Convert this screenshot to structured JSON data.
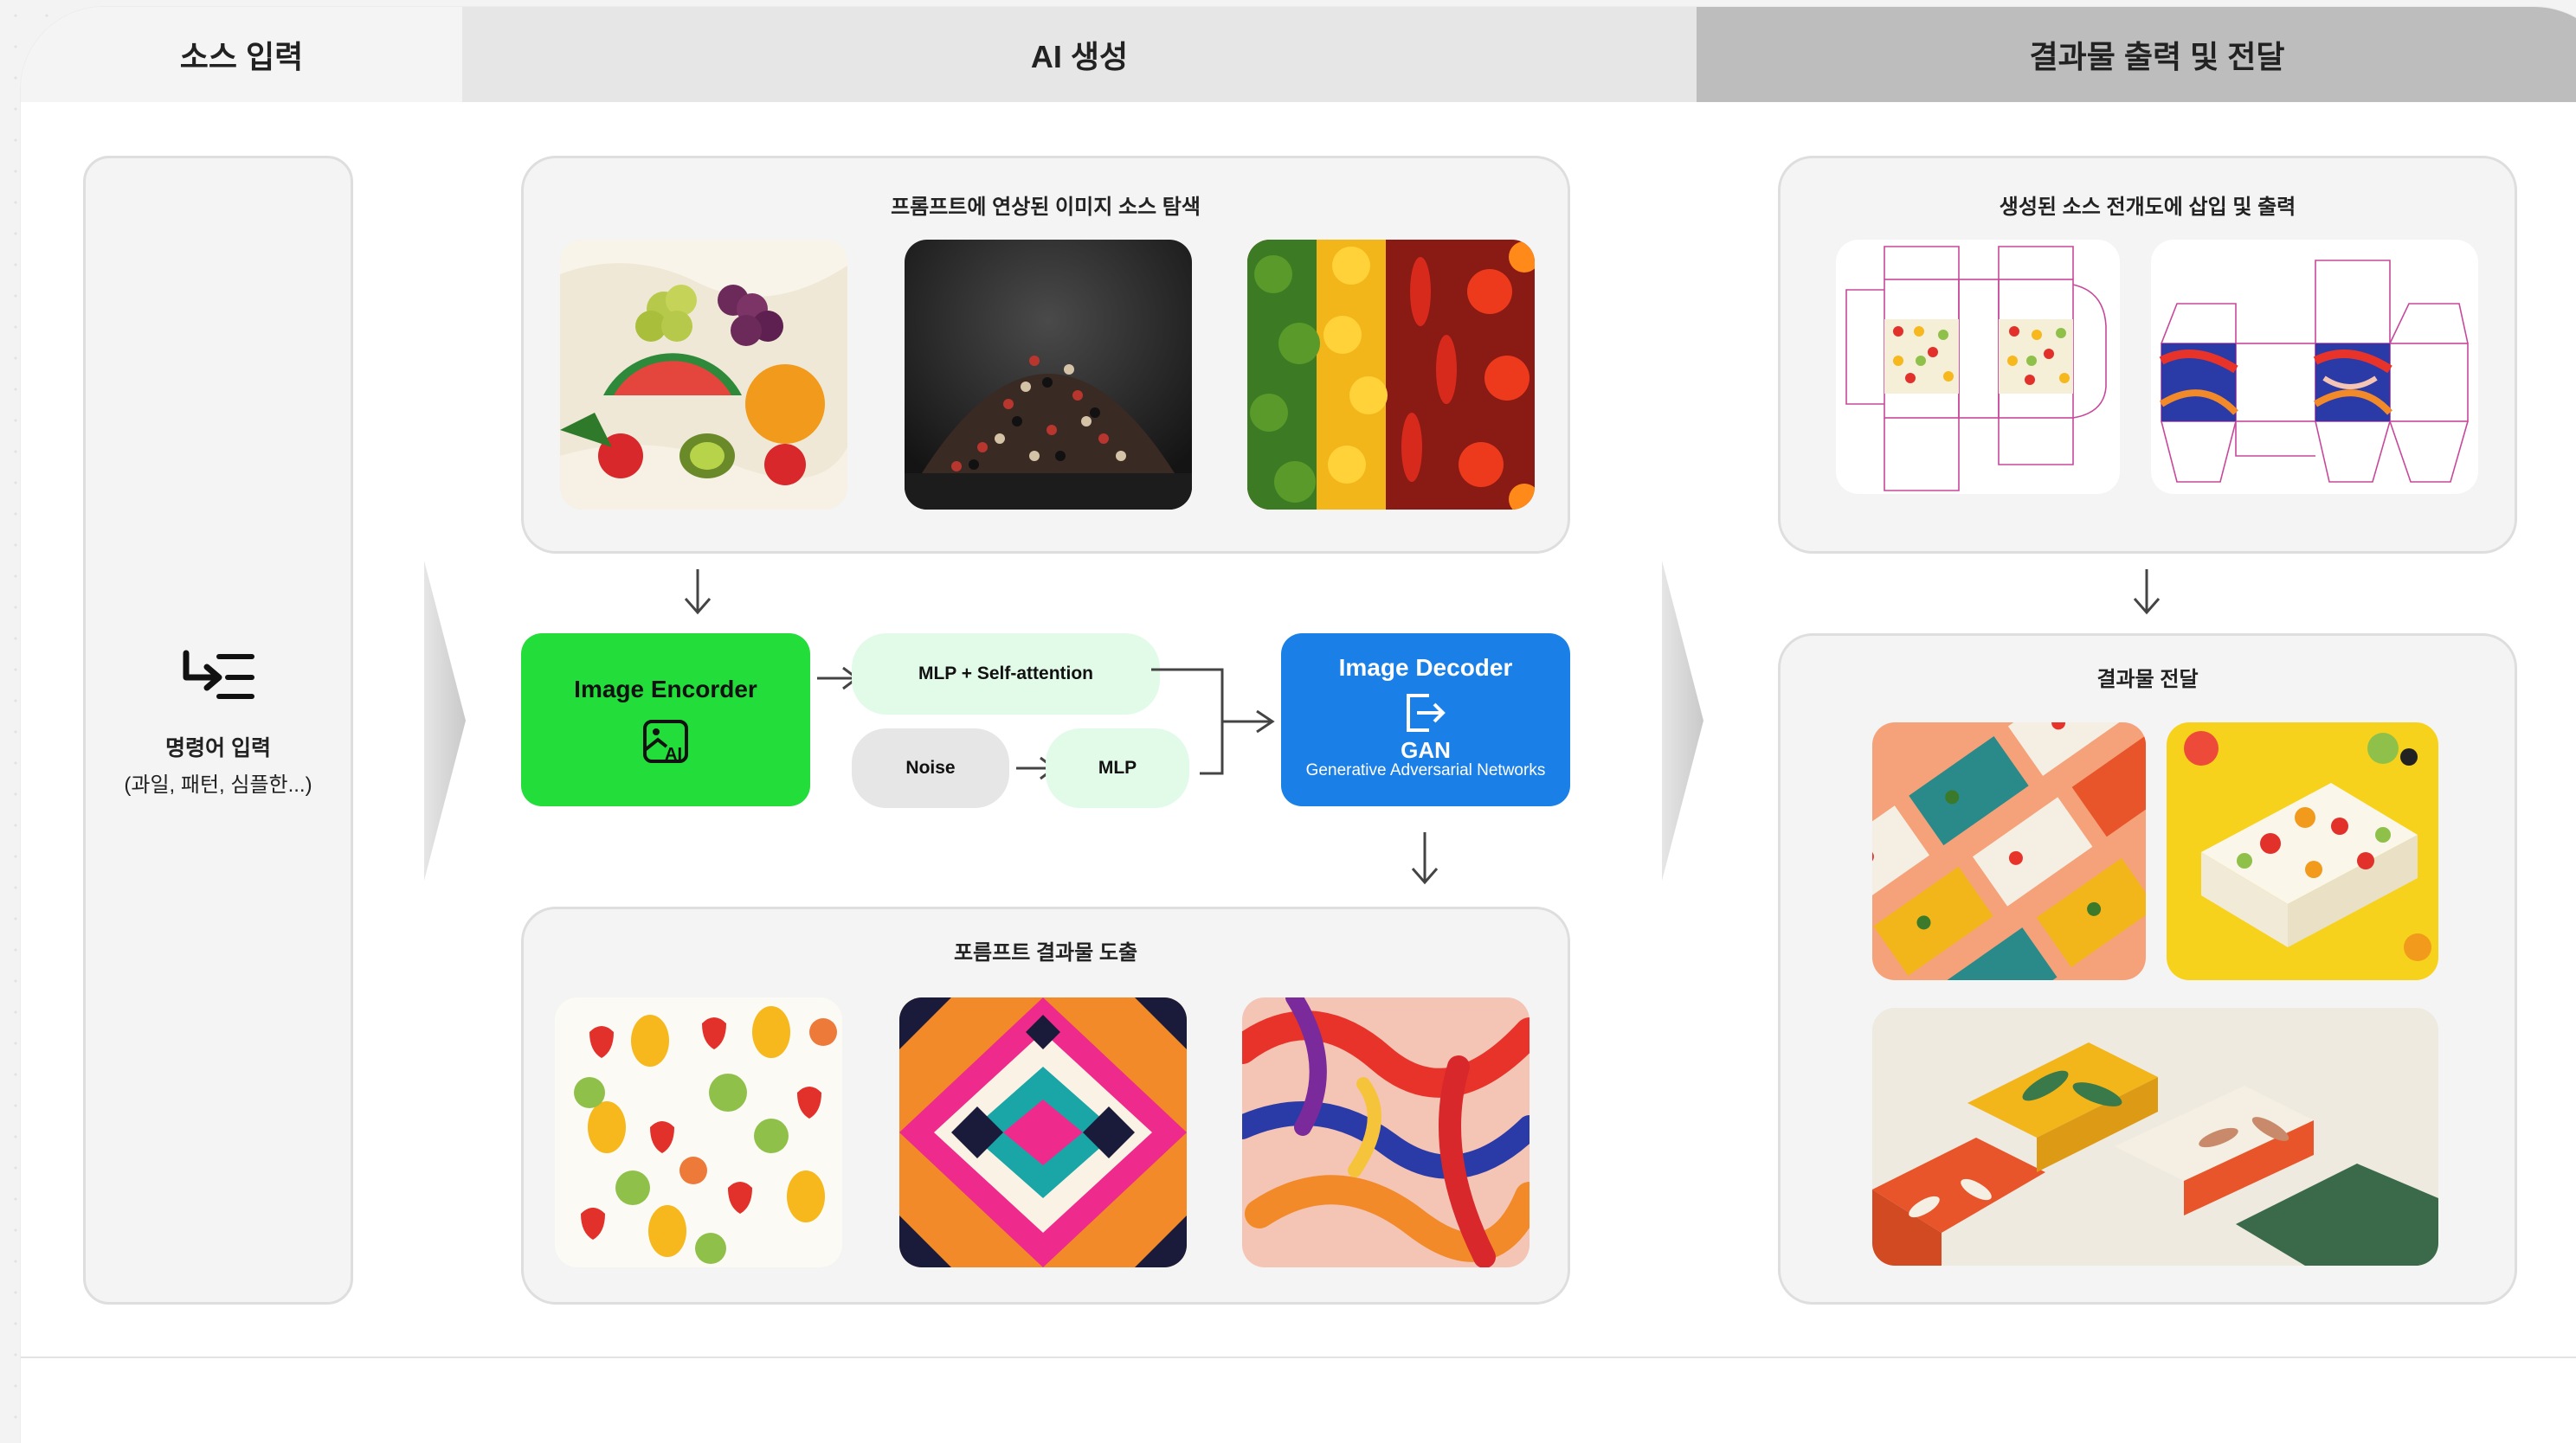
{
  "headers": {
    "source_input": "소스 입력",
    "ai_generation": "AI 생성",
    "output_delivery": "결과물 출력 및 전달"
  },
  "input_panel": {
    "icon": "prompt-input-icon",
    "label": "명령어 입력",
    "sublabel": "(과일, 패턴, 심플한...)"
  },
  "search_panel": {
    "title": "프롬프트에 연상된 이미지 소스 탐색",
    "images": [
      "fruit-still-life",
      "peppercorn-pile",
      "chili-peppers"
    ]
  },
  "model": {
    "encoder_label": "Image Encorder",
    "encoder_icon": "ai-image-icon",
    "mlp_attention_label": "MLP + Self-attention",
    "noise_label": "Noise",
    "mlp_label": "MLP",
    "decoder_label": "Image Decoder",
    "decoder_icon": "export-icon",
    "gan_label": "GAN",
    "gan_sublabel": "Generative Adversarial Networks"
  },
  "result_panel": {
    "title": "포름프트 결과물 도출",
    "images": [
      "fruit-pattern",
      "geometric-pattern",
      "chili-pattern"
    ]
  },
  "dieline_panel": {
    "title": "생성된 소스 전개도에 삽입 및 출력",
    "images": [
      "fruit-box-dieline",
      "abstract-box-dieline"
    ]
  },
  "delivery_panel": {
    "title": "결과물 전달",
    "images": [
      "pattern-boxes-flatlay",
      "fruit-box-yellow",
      "leaf-boxes"
    ]
  },
  "colors": {
    "encoder": "#22dd3a",
    "decoder": "#1a7fe6",
    "mlp": "#e2fbe8",
    "noise": "#e6e6e6",
    "panel": "#f4f4f4"
  }
}
